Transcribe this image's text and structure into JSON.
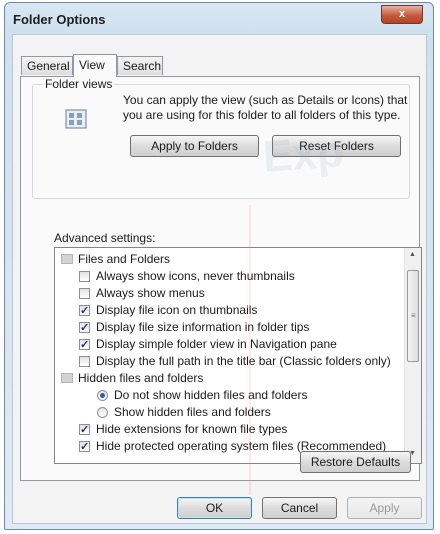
{
  "window": {
    "title": "Folder Options",
    "close_glyph": "x"
  },
  "tabs": [
    {
      "label": "General",
      "active": false
    },
    {
      "label": "View",
      "active": true
    },
    {
      "label": "Search",
      "active": false
    }
  ],
  "folder_views": {
    "label": "Folder views",
    "description": "You can apply the view (such as Details or Icons) that you are using for this folder to all folders of this type.",
    "apply_label": "Apply to Folders",
    "reset_label": "Reset Folders"
  },
  "advanced": {
    "label": "Advanced settings:",
    "items": [
      {
        "label": "Files and Folders",
        "type": "folder",
        "checked": false
      },
      {
        "label": "Always show icons, never thumbnails",
        "type": "checkbox",
        "checked": false
      },
      {
        "label": "Always show menus",
        "type": "checkbox",
        "checked": false
      },
      {
        "label": "Display file icon on thumbnails",
        "type": "checkbox",
        "checked": true
      },
      {
        "label": "Display file size information in folder tips",
        "type": "checkbox",
        "checked": true
      },
      {
        "label": "Display simple folder view in Navigation pane",
        "type": "checkbox",
        "checked": true
      },
      {
        "label": "Display the full path in the title bar (Classic folders only)",
        "type": "checkbox",
        "checked": false
      },
      {
        "label": "Hidden files and folders",
        "type": "folder",
        "checked": false
      },
      {
        "label": "Do not show hidden files and folders",
        "type": "radio",
        "checked": true
      },
      {
        "label": "Show hidden files and folders",
        "type": "radio",
        "checked": false
      },
      {
        "label": "Hide extensions for known file types",
        "type": "checkbox",
        "checked": true
      },
      {
        "label": "Hide protected operating system files (Recommended)",
        "type": "checkbox",
        "checked": true
      }
    ]
  },
  "buttons": {
    "restore_label": "Restore Defaults",
    "ok_label": "OK",
    "cancel_label": "Cancel",
    "apply_label": "Apply"
  },
  "watermark": "Exp",
  "colors": {
    "accent": "#3c7fb1",
    "frame": "#cfe0ef",
    "check": "#1f3a69"
  }
}
